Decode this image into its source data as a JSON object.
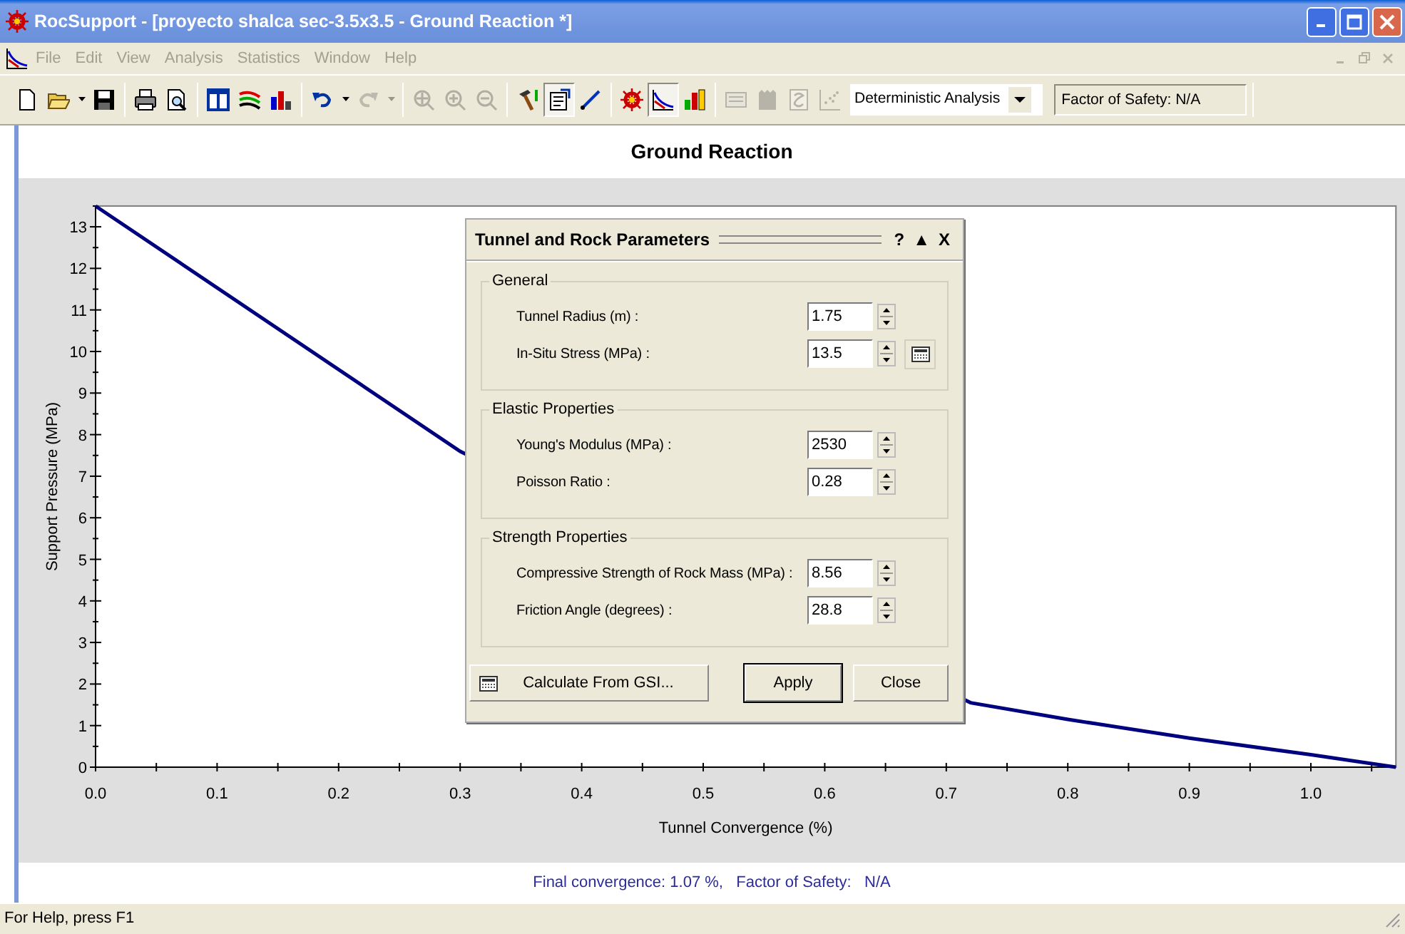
{
  "window": {
    "title": "RocSupport - [proyecto shalca sec-3.5x3.5 - Ground Reaction *]"
  },
  "menu": [
    "File",
    "Edit",
    "View",
    "Analysis",
    "Statistics",
    "Window",
    "Help"
  ],
  "toolbar": {
    "buttons": [
      {
        "disabled": false,
        "pressed": false
      },
      {
        "disabled": false,
        "pressed": false
      },
      {
        "disabled": false,
        "pressed": false
      },
      {
        "disabled": false,
        "pressed": false
      },
      {
        "disabled": false,
        "pressed": false
      },
      {
        "disabled": false,
        "pressed": false
      },
      {
        "disabled": false,
        "pressed": false
      },
      {
        "disabled": false,
        "pressed": false
      },
      {
        "disabled": false,
        "pressed": false
      },
      {
        "disabled": false,
        "pressed": false
      },
      {
        "disabled": false,
        "pressed": false
      },
      {
        "disabled": true,
        "pressed": false
      },
      {
        "disabled": true,
        "pressed": false
      },
      {
        "disabled": true,
        "pressed": false
      },
      {
        "disabled": true,
        "pressed": false
      },
      {
        "disabled": true,
        "pressed": false
      },
      {
        "disabled": false,
        "pressed": false
      },
      {
        "disabled": false,
        "pressed": true
      },
      {
        "disabled": false,
        "pressed": false
      },
      {
        "disabled": false,
        "pressed": false
      },
      {
        "disabled": false,
        "pressed": true
      },
      {
        "disabled": false,
        "pressed": false
      },
      {
        "disabled": true,
        "pressed": false
      },
      {
        "disabled": true,
        "pressed": false
      },
      {
        "disabled": true,
        "pressed": false
      },
      {
        "disabled": true,
        "pressed": false
      }
    ],
    "analysis_type": "Deterministic Analysis",
    "factor_of_safety": "Factor of Safety: N/A"
  },
  "chart": {
    "chart_data": {
      "type": "line",
      "title": "Ground Reaction",
      "xlabel": "Tunnel Convergence (%)",
      "ylabel": "Support Pressure (MPa)",
      "x": [
        0,
        0.3,
        0.72,
        0.8,
        0.9,
        1.0,
        1.07
      ],
      "series": [
        {
          "color": "#00007f",
          "values": [
            13.5,
            7.6,
            1.55,
            1.15,
            0.7,
            0.3,
            0
          ]
        }
      ],
      "xlim": [
        0,
        1.07
      ],
      "ylim": [
        0,
        13.5
      ],
      "xticks": [
        {
          "value": 0,
          "label": "0.0"
        },
        0.1,
        0.2,
        0.3,
        0.4,
        0.5,
        0.6,
        0.7,
        0.8,
        0.9,
        {
          "value": 1,
          "label": "1.0"
        }
      ],
      "yticks": [
        0,
        1,
        2,
        3,
        4,
        5,
        6,
        7,
        8,
        9,
        10,
        11,
        12,
        13
      ]
    }
  },
  "dialog": {
    "title": "Tunnel and Rock Parameters",
    "title_buttons": [
      "?",
      "▲",
      "X"
    ],
    "groups": [
      {
        "label": "General",
        "fields": [
          {
            "label": "Tunnel Radius (m) :",
            "value": "1.75",
            "calculator": false
          },
          {
            "label": "In-Situ Stress (MPa) :",
            "value": "13.5",
            "calculator": true
          }
        ]
      },
      {
        "label": "Elastic Properties",
        "fields": [
          {
            "label": "Young's Modulus (MPa) :",
            "value": "2530",
            "calculator": false
          },
          {
            "label": "Poisson Ratio :",
            "value": "0.28",
            "calculator": false
          }
        ]
      },
      {
        "label": "Strength Properties",
        "fields": [
          {
            "label": "Compressive Strength of Rock Mass (MPa) :",
            "value": "8.56",
            "calculator": false
          },
          {
            "label": "Friction Angle (degrees) :",
            "value": "28.8",
            "calculator": false
          }
        ]
      }
    ],
    "buttons": [
      {
        "label": "Calculate From GSI...",
        "kind": "calculator"
      },
      {
        "label": "Apply",
        "kind": "default"
      },
      {
        "label": "Close",
        "kind": "plain"
      }
    ]
  },
  "summary": "Final convergence: 1.07 %,   Factor of Safety:   N/A",
  "status_bar": "For Help, press F1"
}
